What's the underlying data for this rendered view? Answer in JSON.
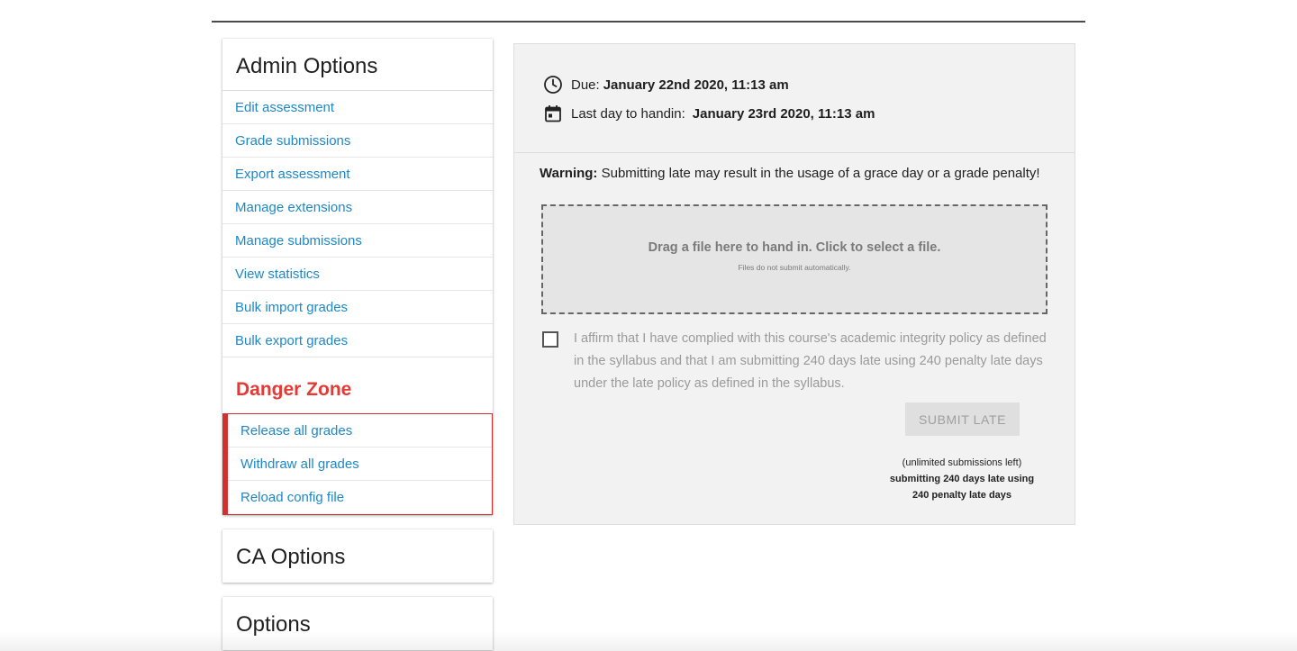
{
  "sidebar": {
    "admin_title": "Admin Options",
    "admin_items": [
      {
        "label": "Edit assessment"
      },
      {
        "label": "Grade submissions"
      },
      {
        "label": "Export assessment"
      },
      {
        "label": "Manage extensions"
      },
      {
        "label": "Manage submissions"
      },
      {
        "label": "View statistics"
      },
      {
        "label": "Bulk import grades"
      },
      {
        "label": "Bulk export grades"
      }
    ],
    "danger_title": "Danger Zone",
    "danger_items": [
      {
        "label": "Release all grades"
      },
      {
        "label": "Withdraw all grades"
      },
      {
        "label": "Reload config file"
      }
    ],
    "ca_title": "CA Options",
    "options_title": "Options"
  },
  "main": {
    "due_label": "Due:",
    "due_value": "January 22nd 2020, 11:13 am",
    "last_day_label": "Last day to handin:",
    "last_day_value": "January 23rd 2020, 11:13 am",
    "warning_label": "Warning:",
    "warning_text": "Submitting late may result in the usage of a grace day or a grade penalty!",
    "dropzone_main": "Drag a file here to hand in. Click to select a file.",
    "dropzone_sub": "Files do not submit automatically.",
    "affirm_text": "I affirm that I have complied with this course's academic integrity policy as defined in the syllabus and that I am submitting 240 days late using 240 penalty late days under the late policy as defined in the syllabus.",
    "submit_label": "Submit Late",
    "submissions_left": "(unlimited submissions left)",
    "late_line1": "submitting 240 days late using",
    "late_line2": "240 penalty late days"
  },
  "icons": {
    "due": "clock-icon",
    "last_day": "calendar-icon"
  },
  "colors": {
    "link": "#1e88c7",
    "danger": "#e53935",
    "panel_bg": "#f3f2f2"
  }
}
